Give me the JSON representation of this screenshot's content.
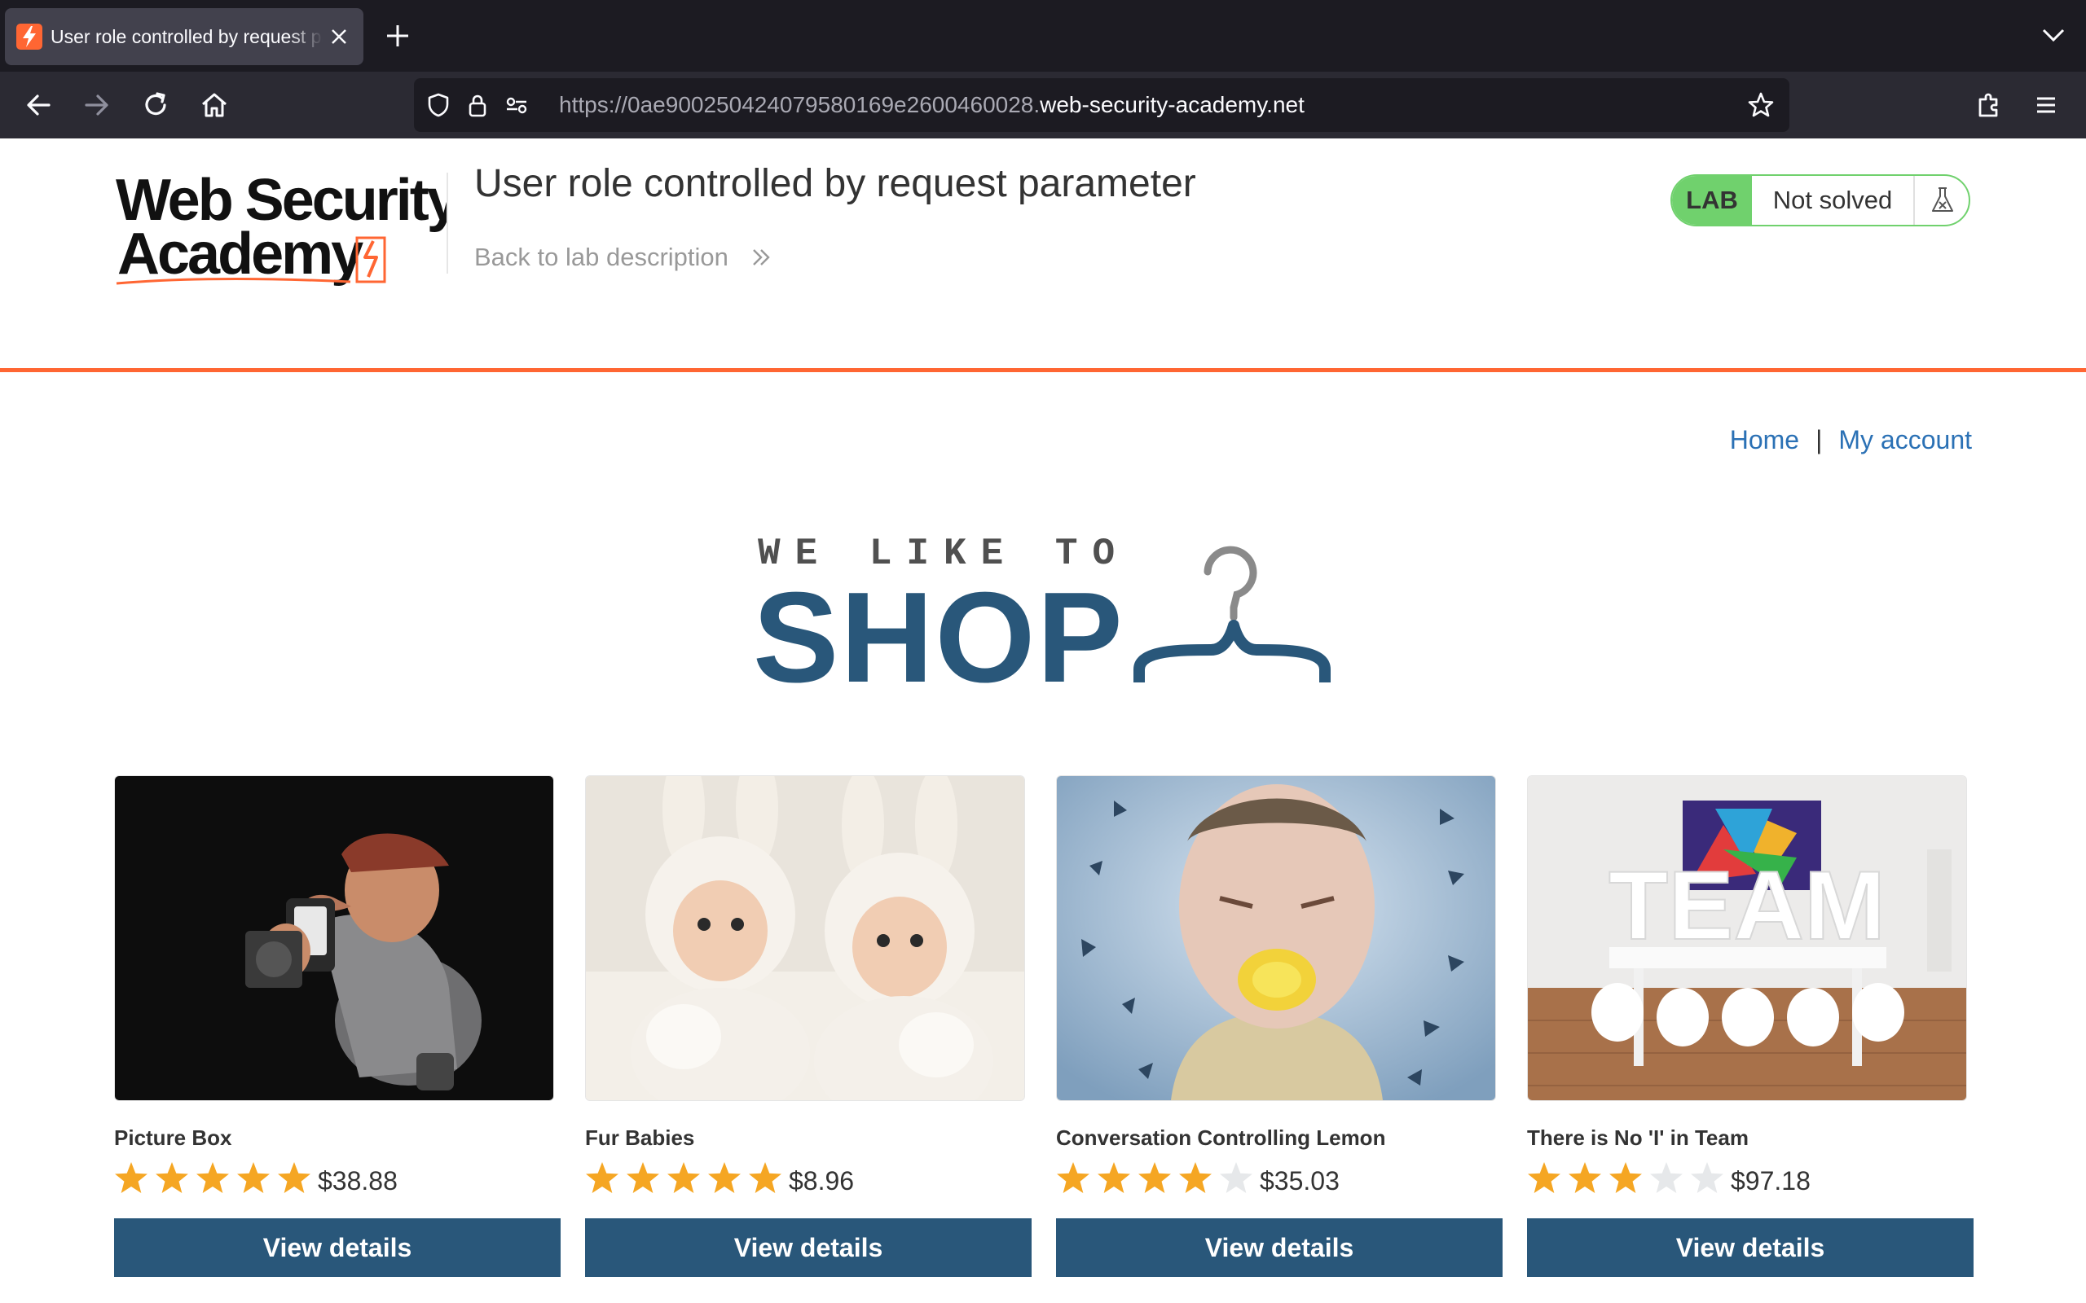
{
  "browser": {
    "tab_title": "User role controlled by request parameter",
    "url_prefix": "https://0ae900250424079580169e2600460028.",
    "url_host": "web-security-academy.net"
  },
  "header": {
    "logo_text": "Web Security Academy",
    "lab_title": "User role controlled by request parameter",
    "back_link": "Back to lab description",
    "lab_tag": "LAB",
    "lab_status": "Not solved"
  },
  "nav": {
    "home": "Home",
    "separator": "|",
    "my_account": "My account"
  },
  "hero": {
    "line1": "WE LIKE TO",
    "line2": "SHOP"
  },
  "products": [
    {
      "name": "Picture Box",
      "rating": 5,
      "price": "$38.88",
      "button": "View details"
    },
    {
      "name": "Fur Babies",
      "rating": 5,
      "price": "$8.96",
      "button": "View details"
    },
    {
      "name": "Conversation Controlling Lemon",
      "rating": 4,
      "price": "$35.03",
      "button": "View details"
    },
    {
      "name": "There is No 'I' in Team",
      "rating": 3,
      "price": "$97.18",
      "button": "View details"
    }
  ],
  "colors": {
    "accent_orange": "#ff6633",
    "brand_blue": "#29577a",
    "link_blue": "#2b71b5",
    "lab_green": "#70d16d",
    "star_gold": "#f5a623"
  }
}
